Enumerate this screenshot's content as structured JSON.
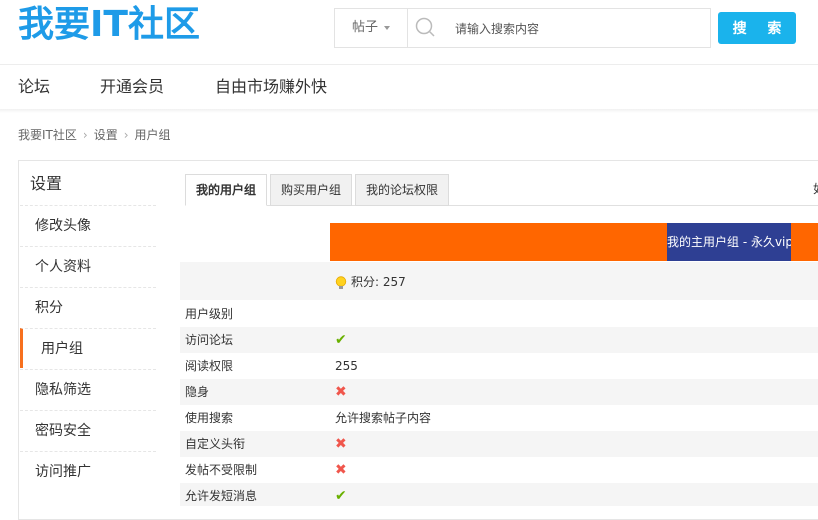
{
  "header": {
    "logo": "我要IT社区",
    "search": {
      "type_label": "帖子",
      "placeholder": "请输入搜索内容",
      "button_label": "搜 索"
    }
  },
  "nav": {
    "items": [
      "论坛",
      "开通会员",
      "自由市场赚外快"
    ]
  },
  "breadcrumb": {
    "items": [
      "我要IT社区",
      "设置",
      "用户组"
    ]
  },
  "sidebar": {
    "title": "设置",
    "items": [
      "修改头像",
      "个人资料",
      "积分",
      "用户组",
      "隐私筛选",
      "密码安全",
      "访问推广"
    ],
    "active_index": 3
  },
  "tabs": [
    "我的用户组",
    "购买用户组",
    "我的论坛权限"
  ],
  "right_clip_text": "如",
  "group_header": {
    "main_group": "我的主用户组 - 永久vip",
    "points_label": "积分: 257"
  },
  "permissions": [
    {
      "label": "用户级别",
      "type": "text",
      "value": ""
    },
    {
      "label": "访问论坛",
      "type": "check",
      "value": "✔"
    },
    {
      "label": "阅读权限",
      "type": "text",
      "value": "255"
    },
    {
      "label": "隐身",
      "type": "cross",
      "value": "✖"
    },
    {
      "label": "使用搜索",
      "type": "text",
      "value": "允许搜索帖子内容"
    },
    {
      "label": "自定义头衔",
      "type": "cross",
      "value": "✖"
    },
    {
      "label": "发帖不受限制",
      "type": "cross",
      "value": "✖"
    },
    {
      "label": "允许发短消息",
      "type": "check",
      "value": "✔"
    }
  ],
  "colors": {
    "brand": "#1e9be8",
    "search_button": "#1ab3ec",
    "orange_bar": "#ff6600",
    "group_box": "#2e3f93",
    "active_marker": "#f7701e",
    "check": "#69b000",
    "cross": "#f0564c"
  }
}
